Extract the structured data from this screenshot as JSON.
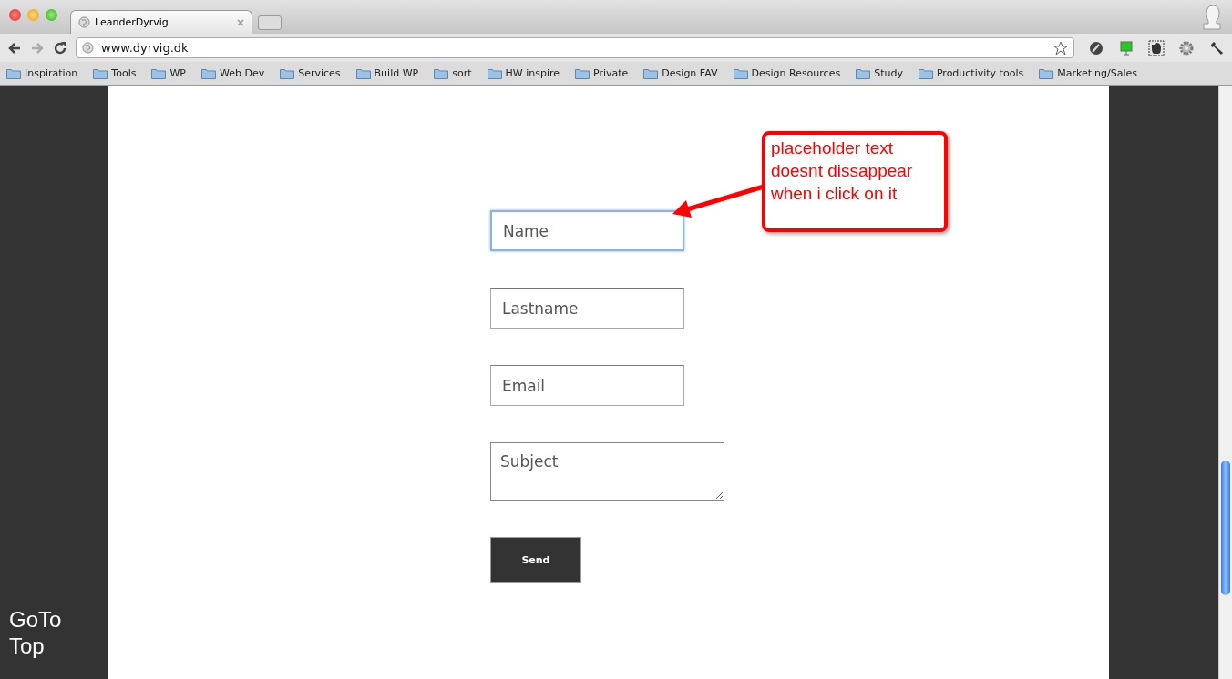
{
  "tabs": [
    {
      "title": "LeanderDyrvig",
      "selected": true
    }
  ],
  "address_bar": {
    "url": "www.dyrvig.dk"
  },
  "bookmarks": [
    "Inspiration",
    "Tools",
    "WP",
    "Web Dev",
    "Services",
    "Build WP",
    "sort",
    "HW inspire",
    "Private",
    "Design FAV",
    "Design Resources",
    "Study",
    "Productivity tools",
    "Marketing/Sales"
  ],
  "form": {
    "fields": [
      {
        "kind": "input",
        "placeholder": "Name",
        "focused": true
      },
      {
        "kind": "input",
        "placeholder": "Lastname",
        "focused": false
      },
      {
        "kind": "input",
        "placeholder": "Email",
        "focused": false
      },
      {
        "kind": "textarea",
        "placeholder": "Subject",
        "focused": false
      }
    ],
    "submit": "Send"
  },
  "annotation": {
    "text": "placeholder text doesnt dissappear when i click on it"
  },
  "go_to_top": "GoTo Top"
}
